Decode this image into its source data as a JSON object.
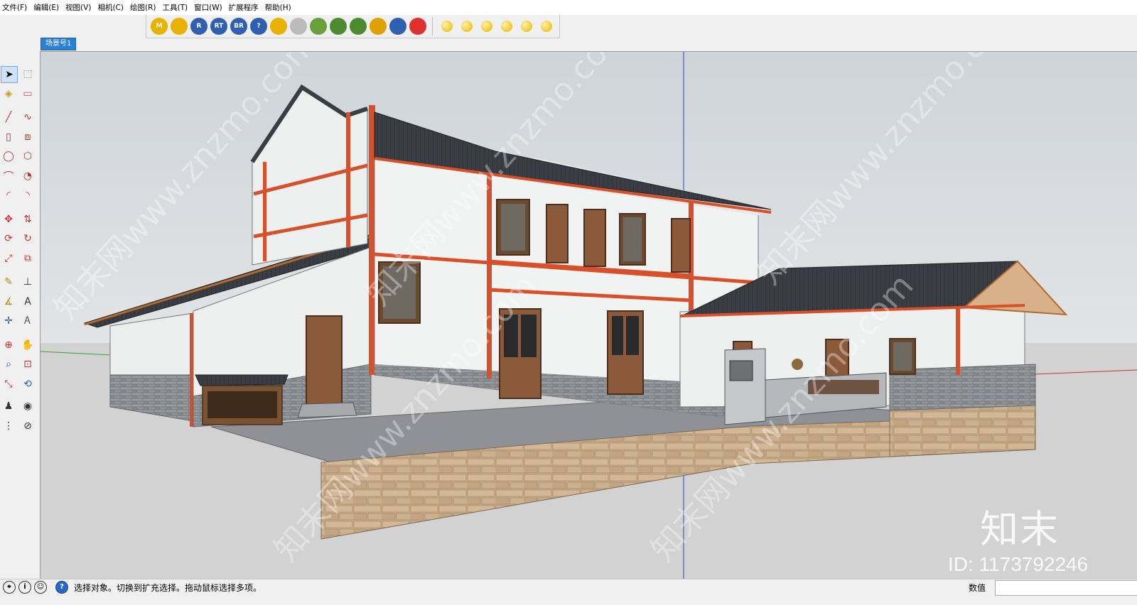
{
  "menu": [
    "文件(F)",
    "编辑(E)",
    "视图(V)",
    "相机(C)",
    "绘图(R)",
    "工具(T)",
    "窗口(W)",
    "扩展程序",
    "帮助(H)"
  ],
  "toolbar": {
    "buttons": [
      {
        "label": "M",
        "icon": "move-m-icon",
        "color": "#e8b200"
      },
      {
        "label": "",
        "icon": "tag-icon",
        "color": "#e8b200"
      },
      {
        "label": "R",
        "icon": "render-r-icon",
        "color": "#2f5fb0"
      },
      {
        "label": "RT",
        "icon": "render-rt-icon",
        "color": "#2f5fb0"
      },
      {
        "label": "BR",
        "icon": "render-br-icon",
        "color": "#2f5fb0"
      },
      {
        "label": "?",
        "icon": "help-icon",
        "color": "#2f5fb0"
      },
      {
        "label": "",
        "icon": "paint-tag-icon",
        "color": "#e8b200"
      },
      {
        "label": "",
        "icon": "sphere-icon",
        "color": "#bbbbbb"
      },
      {
        "label": "",
        "icon": "grass-icon",
        "color": "#6aa03a"
      },
      {
        "label": "",
        "icon": "tree-icon",
        "color": "#4c8c2f"
      },
      {
        "label": "",
        "icon": "tree-2-icon",
        "color": "#4c8c2f"
      },
      {
        "label": "",
        "icon": "target-icon",
        "color": "#e0a000"
      },
      {
        "label": "",
        "icon": "pause-icon",
        "color": "#2f5fb0"
      },
      {
        "label": "",
        "icon": "color-wheel-icon",
        "color": "#e03030"
      }
    ],
    "buttons2": [
      {
        "icon": "sun-ball-icon",
        "color": "#e8b200"
      },
      {
        "icon": "light-icon",
        "color": "#e8b200"
      },
      {
        "icon": "spot-light-icon",
        "color": "#e8b200"
      },
      {
        "icon": "dome-light-icon",
        "color": "#e8b200"
      },
      {
        "icon": "omni-light-icon",
        "color": "#e8b200"
      },
      {
        "icon": "ies-light-icon",
        "color": "#e8b200"
      }
    ]
  },
  "scene_tab": "场景号1",
  "tools": [
    "select-icon",
    "component-icon",
    "paint-bucket-icon",
    "eraser-icon",
    "line-icon",
    "freehand-icon",
    "rectangle-icon",
    "rotated-rectangle-icon",
    "circle-icon",
    "polygon-icon",
    "arc-icon",
    "pie-icon",
    "arc-3pt-icon",
    "arc-2pt-icon",
    "move-icon",
    "push-pull-icon",
    "rotate-icon",
    "follow-me-icon",
    "scale-icon",
    "offset-icon",
    "tape-measure-icon",
    "dimension-icon",
    "protractor-icon",
    "text-icon",
    "axes-icon",
    "3d-text-icon",
    "orbit-icon",
    "pan-icon",
    "zoom-icon",
    "zoom-window-icon",
    "zoom-extents-icon",
    "zoom-previous-icon",
    "position-camera-icon",
    "look-around-icon",
    "walk-icon",
    "section-plane-icon"
  ],
  "status": {
    "text": "选择对象。切换到扩充选择。拖动鼠标选择多项。",
    "measure_label": "数值",
    "measure_value": ""
  },
  "watermark": {
    "logo": "知末",
    "id": "ID: 1173792246"
  },
  "colors": {
    "sky": "#d7dbde",
    "ground": "#d0d0d0",
    "wall": "#f0f0f0",
    "trim": "#d8502a",
    "roof": "#3a3d44",
    "stone": "#c9ad8c",
    "brick_base": "#8a8d92",
    "door": "#8a5a3a"
  }
}
